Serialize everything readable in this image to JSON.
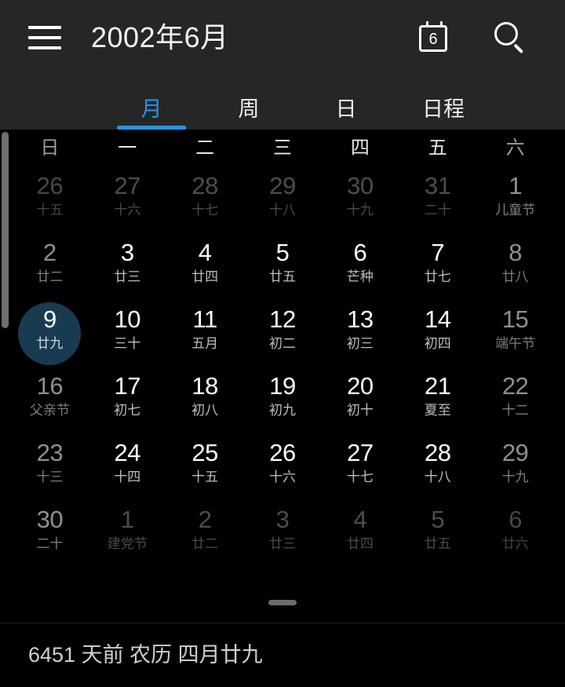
{
  "header": {
    "menu_icon": "hamburger-menu-icon",
    "title": "2002年6月",
    "today_icon": "calendar-today-icon",
    "today_icon_number": "6",
    "search_icon": "search-icon"
  },
  "tabs": [
    {
      "label": "月",
      "active": true
    },
    {
      "label": "周",
      "active": false
    },
    {
      "label": "日",
      "active": false
    },
    {
      "label": "日程",
      "active": false
    }
  ],
  "weekdays": [
    {
      "label": "日",
      "weekend": true
    },
    {
      "label": "一",
      "weekend": false
    },
    {
      "label": "二",
      "weekend": false
    },
    {
      "label": "三",
      "weekend": false
    },
    {
      "label": "四",
      "weekend": false
    },
    {
      "label": "五",
      "weekend": false
    },
    {
      "label": "六",
      "weekend": true
    }
  ],
  "weeks": [
    [
      {
        "num": "26",
        "lunar": "十五",
        "outside": true,
        "weekend": true,
        "selected": false
      },
      {
        "num": "27",
        "lunar": "十六",
        "outside": true,
        "weekend": false,
        "selected": false
      },
      {
        "num": "28",
        "lunar": "十七",
        "outside": true,
        "weekend": false,
        "selected": false
      },
      {
        "num": "29",
        "lunar": "十八",
        "outside": true,
        "weekend": false,
        "selected": false
      },
      {
        "num": "30",
        "lunar": "十九",
        "outside": true,
        "weekend": false,
        "selected": false
      },
      {
        "num": "31",
        "lunar": "二十",
        "outside": true,
        "weekend": false,
        "selected": false
      },
      {
        "num": "1",
        "lunar": "儿童节",
        "outside": false,
        "weekend": true,
        "selected": false
      }
    ],
    [
      {
        "num": "2",
        "lunar": "廿二",
        "outside": false,
        "weekend": true,
        "selected": false
      },
      {
        "num": "3",
        "lunar": "廿三",
        "outside": false,
        "weekend": false,
        "selected": false
      },
      {
        "num": "4",
        "lunar": "廿四",
        "outside": false,
        "weekend": false,
        "selected": false
      },
      {
        "num": "5",
        "lunar": "廿五",
        "outside": false,
        "weekend": false,
        "selected": false
      },
      {
        "num": "6",
        "lunar": "芒种",
        "outside": false,
        "weekend": false,
        "selected": false
      },
      {
        "num": "7",
        "lunar": "廿七",
        "outside": false,
        "weekend": false,
        "selected": false
      },
      {
        "num": "8",
        "lunar": "廿八",
        "outside": false,
        "weekend": true,
        "selected": false
      }
    ],
    [
      {
        "num": "9",
        "lunar": "廿九",
        "outside": false,
        "weekend": true,
        "selected": true
      },
      {
        "num": "10",
        "lunar": "三十",
        "outside": false,
        "weekend": false,
        "selected": false
      },
      {
        "num": "11",
        "lunar": "五月",
        "outside": false,
        "weekend": false,
        "selected": false
      },
      {
        "num": "12",
        "lunar": "初二",
        "outside": false,
        "weekend": false,
        "selected": false
      },
      {
        "num": "13",
        "lunar": "初三",
        "outside": false,
        "weekend": false,
        "selected": false
      },
      {
        "num": "14",
        "lunar": "初四",
        "outside": false,
        "weekend": false,
        "selected": false
      },
      {
        "num": "15",
        "lunar": "端午节",
        "outside": false,
        "weekend": true,
        "selected": false
      }
    ],
    [
      {
        "num": "16",
        "lunar": "父亲节",
        "outside": false,
        "weekend": true,
        "selected": false
      },
      {
        "num": "17",
        "lunar": "初七",
        "outside": false,
        "weekend": false,
        "selected": false
      },
      {
        "num": "18",
        "lunar": "初八",
        "outside": false,
        "weekend": false,
        "selected": false
      },
      {
        "num": "19",
        "lunar": "初九",
        "outside": false,
        "weekend": false,
        "selected": false
      },
      {
        "num": "20",
        "lunar": "初十",
        "outside": false,
        "weekend": false,
        "selected": false
      },
      {
        "num": "21",
        "lunar": "夏至",
        "outside": false,
        "weekend": false,
        "selected": false
      },
      {
        "num": "22",
        "lunar": "十二",
        "outside": false,
        "weekend": true,
        "selected": false
      }
    ],
    [
      {
        "num": "23",
        "lunar": "十三",
        "outside": false,
        "weekend": true,
        "selected": false
      },
      {
        "num": "24",
        "lunar": "十四",
        "outside": false,
        "weekend": false,
        "selected": false
      },
      {
        "num": "25",
        "lunar": "十五",
        "outside": false,
        "weekend": false,
        "selected": false
      },
      {
        "num": "26",
        "lunar": "十六",
        "outside": false,
        "weekend": false,
        "selected": false
      },
      {
        "num": "27",
        "lunar": "十七",
        "outside": false,
        "weekend": false,
        "selected": false
      },
      {
        "num": "28",
        "lunar": "十八",
        "outside": false,
        "weekend": false,
        "selected": false
      },
      {
        "num": "29",
        "lunar": "十九",
        "outside": false,
        "weekend": true,
        "selected": false
      }
    ],
    [
      {
        "num": "30",
        "lunar": "二十",
        "outside": false,
        "weekend": true,
        "selected": false
      },
      {
        "num": "1",
        "lunar": "建党节",
        "outside": true,
        "weekend": false,
        "selected": false
      },
      {
        "num": "2",
        "lunar": "廿二",
        "outside": true,
        "weekend": false,
        "selected": false
      },
      {
        "num": "3",
        "lunar": "廿三",
        "outside": true,
        "weekend": false,
        "selected": false
      },
      {
        "num": "4",
        "lunar": "廿四",
        "outside": true,
        "weekend": false,
        "selected": false
      },
      {
        "num": "5",
        "lunar": "廿五",
        "outside": true,
        "weekend": false,
        "selected": false
      },
      {
        "num": "6",
        "lunar": "廿六",
        "outside": true,
        "weekend": true,
        "selected": false
      }
    ]
  ],
  "drag_handle": "sheet-drag-handle",
  "footer": {
    "text": "6451 天前  农历 四月廿九"
  },
  "colors": {
    "accent": "#2196f3",
    "selection_circle": "#193b52",
    "appbar_background": "#262626",
    "body_background": "#000000"
  }
}
